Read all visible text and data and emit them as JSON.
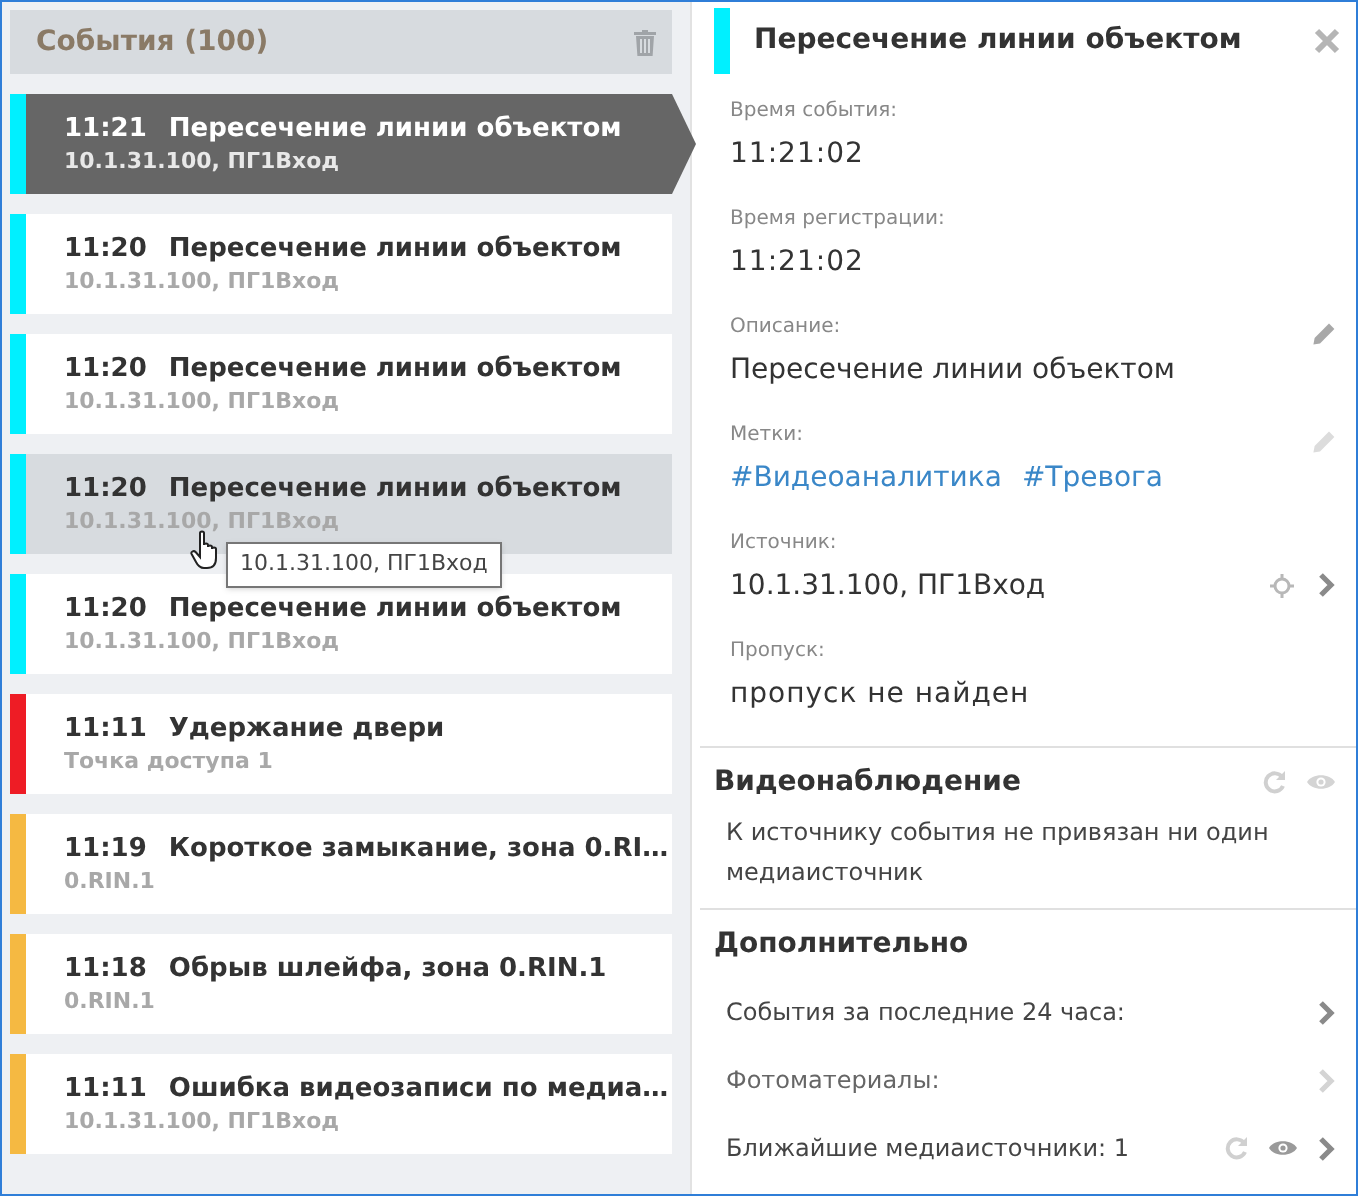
{
  "events_panel": {
    "title": "События (100)"
  },
  "events": [
    {
      "time": "11:21",
      "title": "Пересечение линии объектом",
      "source": "10.1.31.100, ПГ1Вход",
      "color": "#00f0ff",
      "selected": true,
      "hovered": false
    },
    {
      "time": "11:20",
      "title": "Пересечение линии объектом",
      "source": "10.1.31.100, ПГ1Вход",
      "color": "#00f0ff",
      "selected": false,
      "hovered": false
    },
    {
      "time": "11:20",
      "title": "Пересечение линии объектом",
      "source": "10.1.31.100, ПГ1Вход",
      "color": "#00f0ff",
      "selected": false,
      "hovered": false
    },
    {
      "time": "11:20",
      "title": "Пересечение линии объектом",
      "source": "10.1.31.100, ПГ1Вход",
      "color": "#00f0ff",
      "selected": false,
      "hovered": true
    },
    {
      "time": "11:20",
      "title": "Пересечение линии объектом",
      "source": "10.1.31.100, ПГ1Вход",
      "color": "#00f0ff",
      "selected": false,
      "hovered": false
    },
    {
      "time": "11:11",
      "title": "Удержание двери",
      "source": "Точка доступа 1",
      "color": "#ee1c25",
      "selected": false,
      "hovered": false
    },
    {
      "time": "11:19",
      "title": "Короткое замыкание, зона 0.RI…",
      "source": "0.RIN.1",
      "color": "#f5b942",
      "selected": false,
      "hovered": false
    },
    {
      "time": "11:18",
      "title": "Обрыв шлейфа, зона 0.RIN.1",
      "source": "0.RIN.1",
      "color": "#f5b942",
      "selected": false,
      "hovered": false
    },
    {
      "time": "11:11",
      "title": "Ошибка видеозаписи по медиа…",
      "source": "10.1.31.100, ПГ1Вход",
      "color": "#f5b942",
      "selected": false,
      "hovered": false
    }
  ],
  "tooltip": "10.1.31.100, ПГ1Вход",
  "details": {
    "title": "Пересечение линии объектом",
    "color": "#00f0ff",
    "fields": [
      {
        "kind": "text",
        "label": "Время события:",
        "value": "11:21:02"
      },
      {
        "kind": "text",
        "label": "Время регистрации:",
        "value": "11:21:02"
      },
      {
        "kind": "editable",
        "label": "Описание:",
        "value": "Пересечение линии объектом",
        "disabled": false
      },
      {
        "kind": "tags",
        "label": "Метки:",
        "tags": [
          "#Видеоаналитика",
          "#Тревога"
        ],
        "disabled": true
      },
      {
        "kind": "source",
        "label": "Источник:",
        "value": "10.1.31.100, ПГ1Вход"
      },
      {
        "kind": "text",
        "label": "Пропуск:",
        "value": "пропуск не найден"
      }
    ],
    "video": {
      "title": "Видеонаблюдение",
      "message": "К источнику события не привязан ни один медиаисточник"
    },
    "extra": {
      "title": "Дополнительно",
      "items": [
        {
          "label": "События за последние 24 часа:",
          "disabled": false,
          "media_controls": false
        },
        {
          "label": "Фотоматериалы:",
          "disabled": true,
          "media_controls": false
        },
        {
          "label": "Ближайшие медиаисточники: 1",
          "disabled": false,
          "media_controls": true
        }
      ]
    }
  }
}
